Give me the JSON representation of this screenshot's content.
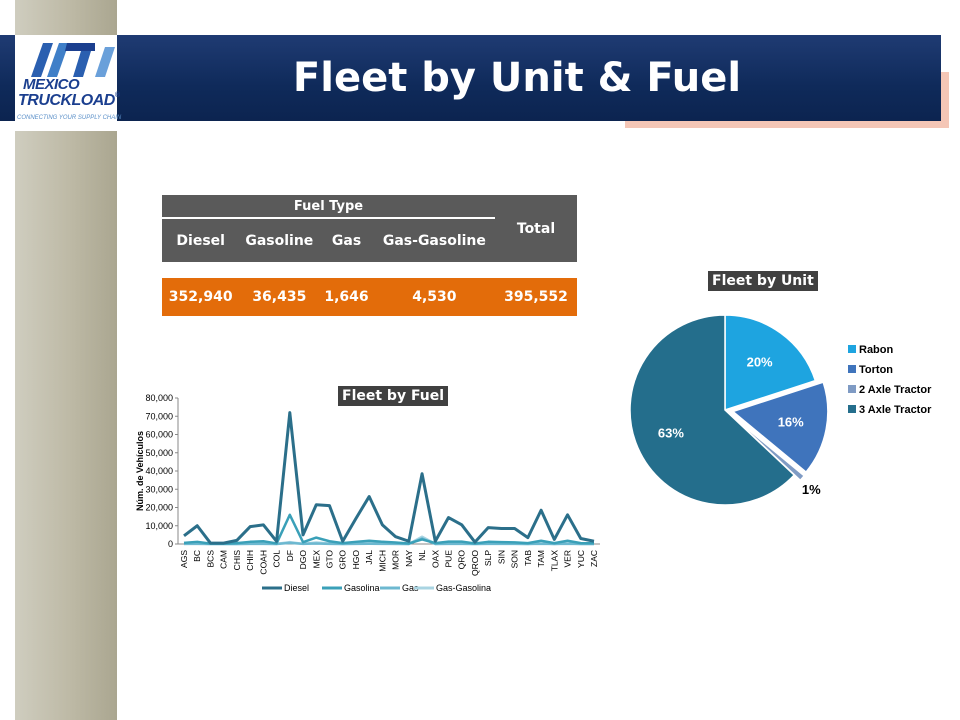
{
  "header": {
    "title": "Fleet by Unit & Fuel",
    "logo_line1": "MEXICO",
    "logo_line2": "TRUCKLOAD",
    "logo_tagline": "CONNECTING YOUR SUPPLY CHAIN",
    "logo_registered": "®"
  },
  "fuel_table": {
    "group_header": "Fuel Type",
    "columns": [
      "Diesel",
      "Gasoline",
      "Gas",
      "Gas-Gasoline"
    ],
    "total_header": "Total",
    "values": [
      "352,940",
      "36,435",
      "1,646",
      "4,530"
    ],
    "total_value": "395,552"
  },
  "chart_data": [
    {
      "type": "pie",
      "title": "Fleet by Unit",
      "labels": [
        "Rabon",
        "Torton",
        "2 Axle Tractor",
        "3 Axle Tractor"
      ],
      "values": [
        20,
        16,
        1,
        63
      ],
      "value_labels": [
        "20%",
        "16%",
        "1%",
        "63%"
      ],
      "colors": [
        "#1ea4e0",
        "#3f74bc",
        "#7f9bc4",
        "#246e8c"
      ],
      "legend": "right"
    },
    {
      "type": "line",
      "title": "Fleet by Fuel",
      "ylabel": "Núm. de Vehículos",
      "ylim": [
        0,
        80000
      ],
      "yticks": [
        0,
        10000,
        20000,
        30000,
        40000,
        50000,
        60000,
        70000,
        80000
      ],
      "ytick_labels": [
        "0",
        "10,000",
        "20,000",
        "30,000",
        "40,000",
        "50,000",
        "60,000",
        "70,000",
        "80,000"
      ],
      "categories": [
        "AGS",
        "BC",
        "BCS",
        "CAM",
        "CHIS",
        "CHIH",
        "COAH",
        "COL",
        "DF",
        "DGO",
        "MEX",
        "GTO",
        "GRO",
        "HGO",
        "JAL",
        "MICH",
        "MOR",
        "NAY",
        "NL",
        "OAX",
        "PUE",
        "QRO",
        "QROO",
        "SLP",
        "SIN",
        "SON",
        "TAB",
        "TAM",
        "TLAX",
        "VER",
        "YUC",
        "ZAC"
      ],
      "legend": "bottom",
      "series": [
        {
          "name": "Diesel",
          "color": "#2b6f8a",
          "values": [
            4500,
            10000,
            500,
            500,
            2000,
            9500,
            10500,
            1500,
            72000,
            5000,
            21500,
            21000,
            1500,
            14000,
            26000,
            10500,
            4000,
            1500,
            38500,
            1500,
            14500,
            10500,
            1000,
            9000,
            8500,
            8500,
            3500,
            18500,
            2500,
            16000,
            3000,
            1500
          ]
        },
        {
          "name": "Gasolina",
          "color": "#3aa0b8",
          "values": [
            600,
            1200,
            200,
            200,
            500,
            1200,
            1500,
            300,
            16000,
            1000,
            3500,
            1500,
            500,
            1200,
            1800,
            1200,
            800,
            300,
            2500,
            500,
            1300,
            1300,
            300,
            1200,
            1000,
            900,
            500,
            1800,
            500,
            1800,
            500,
            400
          ]
        },
        {
          "name": "Gas",
          "color": "#6db8d0",
          "values": [
            50,
            80,
            20,
            20,
            30,
            80,
            100,
            20,
            600,
            50,
            300,
            100,
            30,
            80,
            150,
            80,
            50,
            20,
            3000,
            30,
            80,
            80,
            20,
            80,
            60,
            60,
            30,
            150,
            30,
            120,
            30,
            20
          ]
        },
        {
          "name": "Gas-Gasolina",
          "color": "#a9d4e2",
          "values": [
            100,
            200,
            50,
            50,
            80,
            150,
            200,
            50,
            1000,
            100,
            800,
            300,
            60,
            200,
            400,
            200,
            100,
            40,
            4000,
            60,
            200,
            200,
            50,
            200,
            150,
            150,
            80,
            300,
            60,
            250,
            60,
            40
          ]
        }
      ]
    }
  ]
}
